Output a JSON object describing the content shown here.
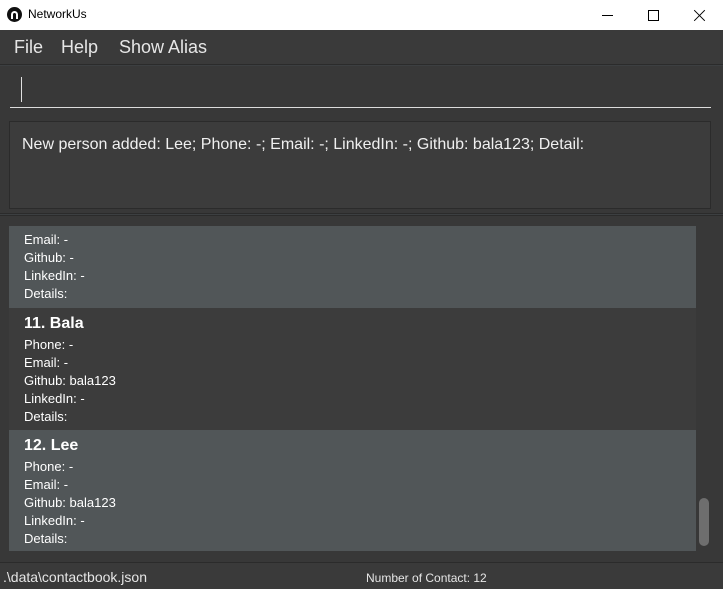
{
  "window": {
    "title": "NetworkUs",
    "icon": "app-logo-icon"
  },
  "menu": {
    "file": "File",
    "help": "Help",
    "show_alias": "Show Alias"
  },
  "command": {
    "value": "",
    "placeholder": ""
  },
  "result": {
    "message": "New person added: Lee; Phone: -; Email: -; LinkedIn: -; Github: bala123; Detail:"
  },
  "contacts": [
    {
      "name": "",
      "fields": [
        "Email: -",
        "Github: -",
        "LinkedIn: -",
        "Details:"
      ]
    },
    {
      "name": "11.  Bala",
      "fields": [
        "Phone: -",
        "Email: -",
        "Github: bala123",
        "LinkedIn: -",
        "Details:"
      ]
    },
    {
      "name": "12.  Lee",
      "fields": [
        "Phone: -",
        "Email: -",
        "Github: bala123",
        "LinkedIn: -",
        "Details:"
      ]
    }
  ],
  "status": {
    "path": ".\\data\\contactbook.json",
    "count": "Number of Contact: 12"
  }
}
